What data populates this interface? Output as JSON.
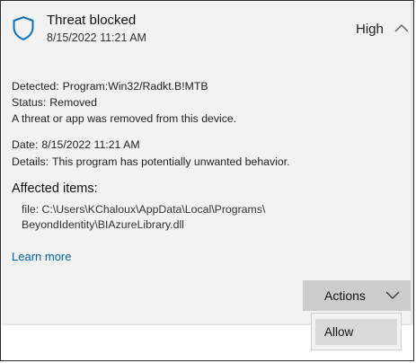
{
  "header": {
    "title": "Threat blocked",
    "timestamp": "8/15/2022 11:21 AM",
    "severity": "High",
    "icon": "shield-icon",
    "accent_color": "#0a6fc2"
  },
  "details": {
    "detected_label": "Detected:",
    "detected_value": "Program:Win32/Radkt.B!MTB",
    "status_label": "Status:",
    "status_value": "Removed",
    "status_message": "A threat or app was removed from this device.",
    "date_label": "Date:",
    "date_value": "8/15/2022 11:21 AM",
    "details_label": "Details:",
    "details_value": "This program has potentially unwanted behavior."
  },
  "affected": {
    "heading": "Affected items:",
    "file_line1": "file: C:\\Users\\KChaloux\\AppData\\Local\\Programs\\",
    "file_line2": "BeyondIdentity\\BIAzureLibrary.dll"
  },
  "learn_more": "Learn more",
  "actions": {
    "label": "Actions",
    "menu_items": [
      "Allow"
    ]
  }
}
